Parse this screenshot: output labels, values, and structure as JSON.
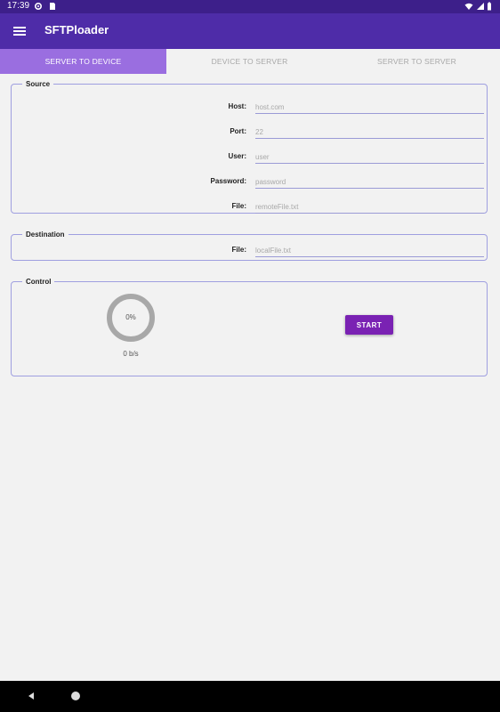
{
  "status_bar": {
    "time": "17:39",
    "icons": [
      "gear-icon",
      "sim-card-icon",
      "wifi-icon",
      "signal-icon",
      "battery-icon"
    ]
  },
  "app_bar": {
    "title": "SFTPloader",
    "menu_icon": "hamburger-menu-icon"
  },
  "tabs": [
    {
      "label": "SERVER TO DEVICE",
      "active": true
    },
    {
      "label": "DEVICE TO SERVER",
      "active": false
    },
    {
      "label": "SERVER TO SERVER",
      "active": false
    }
  ],
  "source": {
    "legend": "Source",
    "fields": [
      {
        "label": "Host:",
        "placeholder": "host.com",
        "value": ""
      },
      {
        "label": "Port:",
        "placeholder": "22",
        "value": ""
      },
      {
        "label": "User:",
        "placeholder": "user",
        "value": ""
      },
      {
        "label": "Password:",
        "placeholder": "password",
        "value": ""
      },
      {
        "label": "File:",
        "placeholder": "remoteFile.txt",
        "value": ""
      }
    ]
  },
  "destination": {
    "legend": "Destination",
    "fields": [
      {
        "label": "File:",
        "placeholder": "localFile.txt",
        "value": ""
      }
    ]
  },
  "control": {
    "legend": "Control",
    "progress_percent": 0,
    "progress_text": "0%",
    "speed": "0 b/s",
    "start_label": "START"
  },
  "colors": {
    "status_bar": "#3d1f8a",
    "app_bar": "#4e2ca8",
    "active_tab": "#9a6ee0",
    "start_button": "#7a22b3",
    "background": "#f2f2f2",
    "border": "#9f9fe0"
  }
}
